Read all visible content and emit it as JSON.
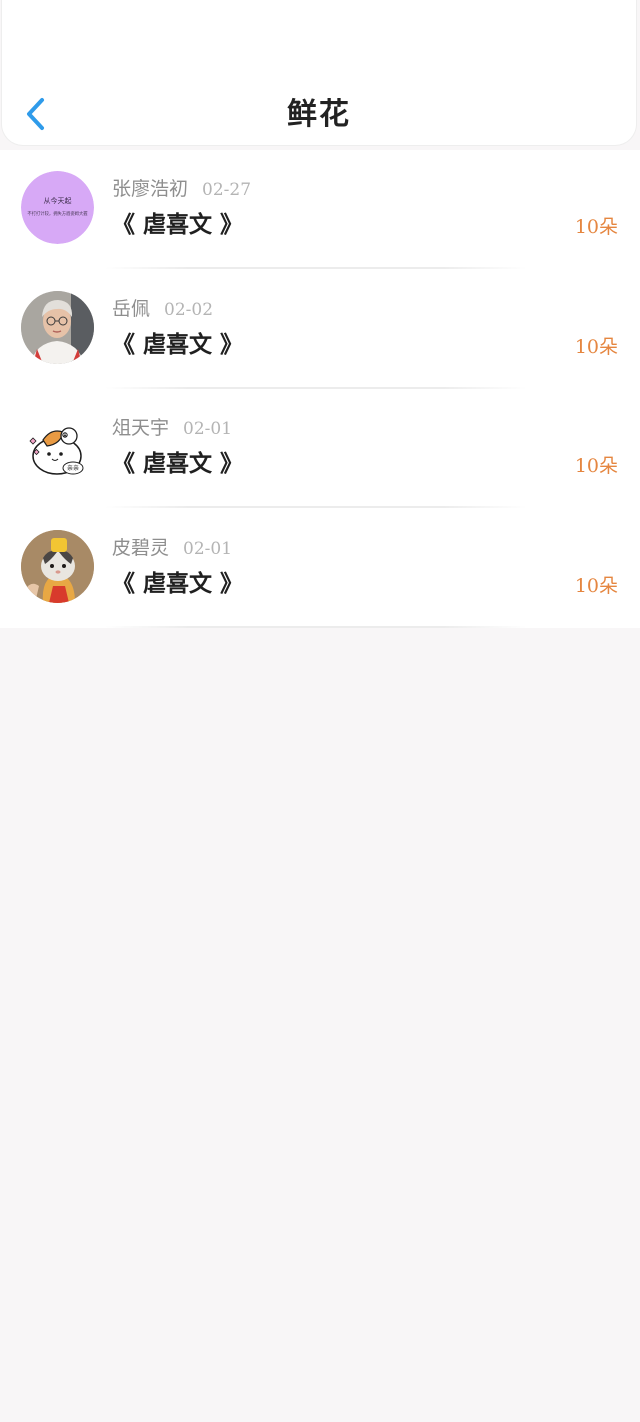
{
  "header": {
    "title": "鲜花",
    "back_icon": "chevron-left-icon",
    "accent_color": "#2f9bea"
  },
  "list": {
    "count_color": "#e58640",
    "items": [
      {
        "name": "张廖浩初",
        "date": "02-27",
        "book": "《 虐喜文 》",
        "count": "10朵",
        "avatar_text": [
          "从今天起",
          "不打打计较，拥失方眉姿姆大握"
        ]
      },
      {
        "name": "岳佩",
        "date": "02-02",
        "book": "《 虐喜文 》",
        "count": "10朵"
      },
      {
        "name": "俎天宇",
        "date": "02-01",
        "book": "《 虐喜文 》",
        "count": "10朵",
        "avatar_text": [
          "亲亲"
        ]
      },
      {
        "name": "皮碧灵",
        "date": "02-01",
        "book": "《 虐喜文 》",
        "count": "10朵"
      }
    ]
  }
}
